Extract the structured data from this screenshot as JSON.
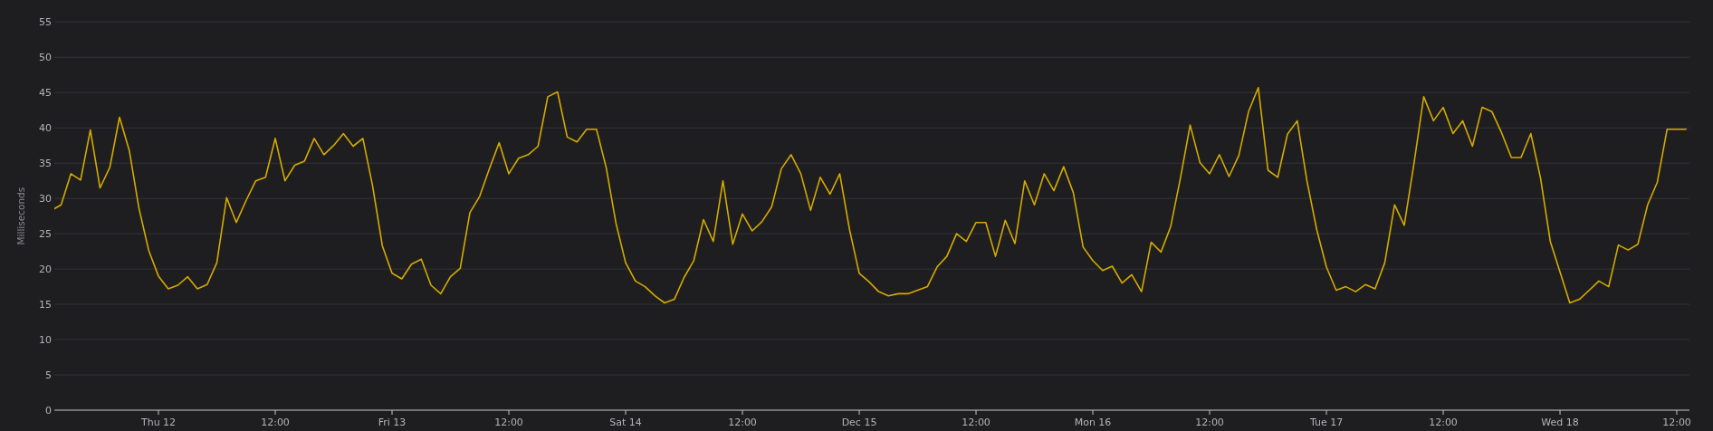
{
  "chart": {
    "chart_data": {
      "type": "line",
      "ylabel": "Milliseconds",
      "grid": true,
      "categories": [
        null,
        null,
        null,
        null,
        null,
        null,
        null,
        null,
        null,
        null,
        null,
        "Thu 12",
        null,
        null,
        null,
        null,
        null,
        null,
        null,
        null,
        null,
        null,
        null,
        "12:00",
        null,
        null,
        null,
        null,
        null,
        null,
        null,
        null,
        null,
        null,
        null,
        "Fri 13",
        null,
        null,
        null,
        null,
        null,
        null,
        null,
        null,
        null,
        null,
        null,
        "12:00",
        null,
        null,
        null,
        null,
        null,
        null,
        null,
        null,
        null,
        null,
        null,
        "Sat 14",
        null,
        null,
        null,
        null,
        null,
        null,
        null,
        null,
        null,
        null,
        null,
        "12:00",
        null,
        null,
        null,
        null,
        null,
        null,
        null,
        null,
        null,
        null,
        null,
        "Dec 15",
        null,
        null,
        null,
        null,
        null,
        null,
        null,
        null,
        null,
        null,
        null,
        "12:00",
        null,
        null,
        null,
        null,
        null,
        null,
        null,
        null,
        null,
        null,
        null,
        "Mon 16",
        null,
        null,
        null,
        null,
        null,
        null,
        null,
        null,
        null,
        null,
        null,
        "12:00",
        null,
        null,
        null,
        null,
        null,
        null,
        null,
        null,
        null,
        null,
        null,
        "Tue 17",
        null,
        null,
        null,
        null,
        null,
        null,
        null,
        null,
        null,
        null,
        null,
        "12:00",
        null,
        null,
        null,
        null,
        null,
        null,
        null,
        null,
        null,
        null,
        null,
        "Wed 18",
        null,
        null,
        null,
        null,
        null,
        null,
        null,
        null,
        null,
        null,
        null,
        "12:00",
        null
      ],
      "series": [
        {
          "color": "#d4aa00",
          "values": [
            28.3,
            29.1,
            33.5,
            32.6,
            39.7,
            31.5,
            34.4,
            41.5,
            36.8,
            28.6,
            22.6,
            19.0,
            17.2,
            17.7,
            18.9,
            17.2,
            17.8,
            20.9,
            30.1,
            26.6,
            29.7,
            32.5,
            33.0,
            38.5,
            32.5,
            34.7,
            35.3,
            38.5,
            36.2,
            37.5,
            39.2,
            37.4,
            38.5,
            31.8,
            23.3,
            19.4,
            18.6,
            20.7,
            21.4,
            17.7,
            16.5,
            18.9,
            20.1,
            28.0,
            30.3,
            34.2,
            37.9,
            33.5,
            35.7,
            36.2,
            37.4,
            44.4,
            45.1,
            38.7,
            38.0,
            39.8,
            39.8,
            34.4,
            26.5,
            20.9,
            18.3,
            17.5,
            16.2,
            15.2,
            15.7,
            18.8,
            21.2,
            27.0,
            23.9,
            32.5,
            23.5,
            27.8,
            25.4,
            26.7,
            28.8,
            34.2,
            36.2,
            33.5,
            28.3,
            33.0,
            30.6,
            33.5,
            25.6,
            19.4,
            18.2,
            16.8,
            16.2,
            16.5,
            16.5,
            17.0,
            17.5,
            20.3,
            21.8,
            25.0,
            23.9,
            26.6,
            26.6,
            21.8,
            26.9,
            23.6,
            32.5,
            29.1,
            33.5,
            31.1,
            34.5,
            30.8,
            23.1,
            21.2,
            19.8,
            20.4,
            18.0,
            19.2,
            16.8,
            23.8,
            22.4,
            26.0,
            32.9,
            40.4,
            35.1,
            33.5,
            36.2,
            33.1,
            36.1,
            42.3,
            45.7,
            34.0,
            33.0,
            39.1,
            41.0,
            32.5,
            25.6,
            20.3,
            17.0,
            17.5,
            16.8,
            17.8,
            17.2,
            20.9,
            29.1,
            26.2,
            35.0,
            44.4,
            41.0,
            42.9,
            39.2,
            41.0,
            37.4,
            42.9,
            42.3,
            39.3,
            35.8,
            35.8,
            39.2,
            32.9,
            23.9,
            19.6,
            15.2,
            15.7,
            17.0,
            18.3,
            17.5,
            23.4,
            22.7,
            23.5,
            29.1,
            32.3,
            39.8,
            39.8,
            39.8
          ]
        }
      ],
      "ylim": [
        0,
        55
      ],
      "yticks": [
        0,
        5,
        10,
        15,
        20,
        25,
        30,
        35,
        40,
        45,
        50,
        55
      ]
    }
  }
}
